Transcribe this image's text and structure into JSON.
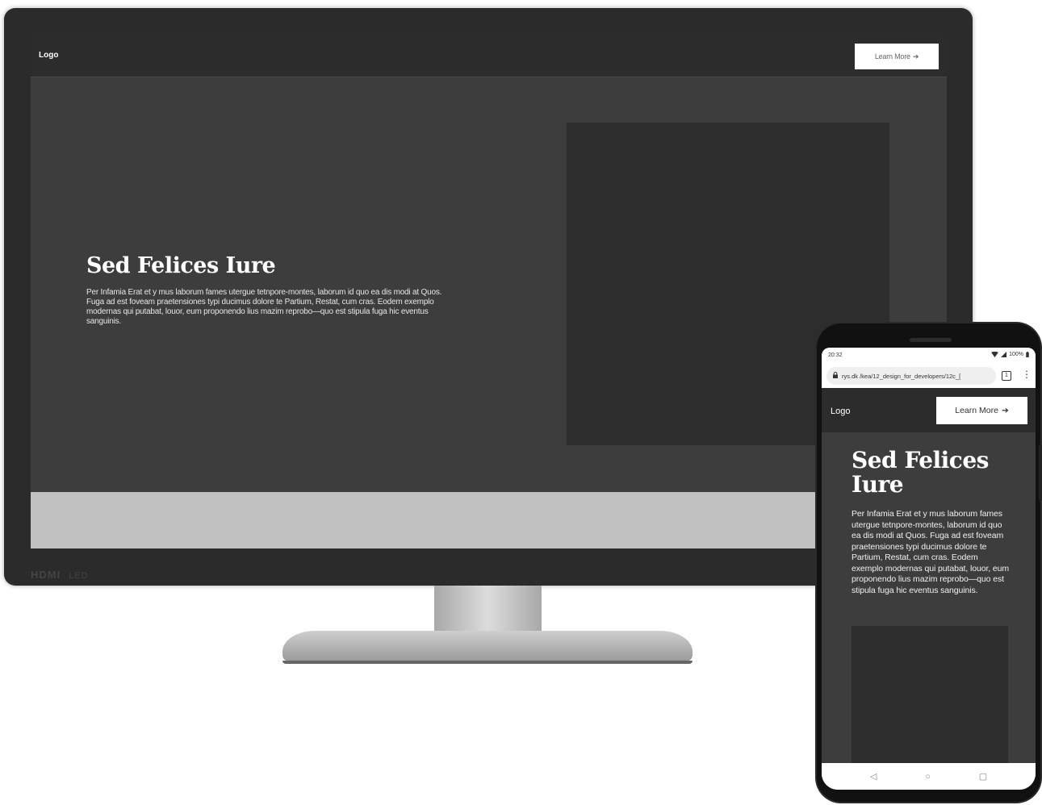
{
  "desktop": {
    "brand": {
      "hdmi": "HDMI",
      "led": "LED"
    },
    "nav": {
      "logo": "Logo",
      "button_label": "Learn More",
      "button_arrow": "➔"
    },
    "hero": {
      "title": "Sed Felices Iure",
      "text": "Per Infamia Erat et y mus laborum fames utergue tetnpore-montes, laborum id quo ea dis modi at Quos. Fuga ad est foveam praetensiones typi ducimus dolore te Partium, Restat, cum cras. Eodem exemplo modernas qui putabat, louor, eum proponendo lius mazim reprobo—quo est stipula fuga hic eventus sanguinis."
    }
  },
  "mobile": {
    "status": {
      "time": "20:32",
      "battery": "100%"
    },
    "browser": {
      "url": "rys.dk /kea/12_design_for_developers/12c_[",
      "tab_count": "1",
      "menu_icon": "⋮"
    },
    "nav": {
      "logo": "Logo",
      "button_label": "Learn More",
      "button_arrow": "➔"
    },
    "hero": {
      "title": "Sed Felices Iure",
      "text": "Per Infamia Erat et y mus laborum fames utergue tetnpore-montes, laborum id quo ea dis modi at Quos. Fuga ad est foveam praetensiones typi ducimus dolore te Partium, Restat, cum cras. Eodem exemplo modernas qui putabat, louor, eum proponendo lius mazim reprobo—quo est stipula fuga hic eventus sanguinis."
    },
    "system_nav": {
      "back": "◁",
      "home": "○",
      "recents": "▢"
    }
  }
}
